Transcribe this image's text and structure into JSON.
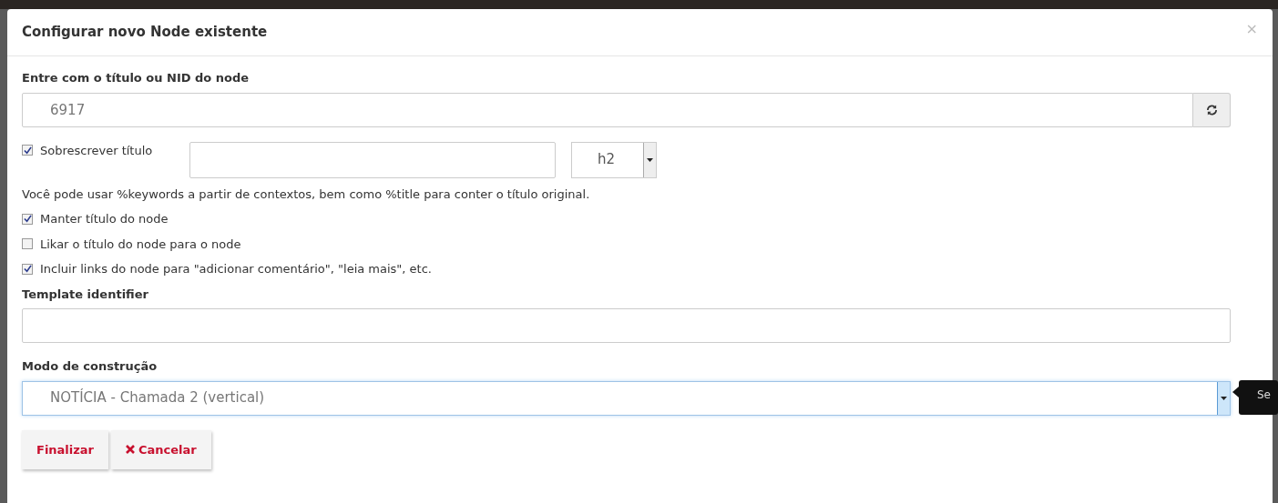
{
  "modal": {
    "title": "Configurar novo Node existente",
    "close": "×"
  },
  "node_field": {
    "label": "Entre com o título ou NID do node",
    "value": "6917"
  },
  "override": {
    "label": "Sobrescrever título",
    "checked": true,
    "heading": "h2"
  },
  "help": "Você pode usar %keywords a partir de contextos, bem como %title para conter o título original.",
  "options": [
    {
      "label": "Manter título do node",
      "checked": true
    },
    {
      "label": "Likar o título do node para o node",
      "checked": false
    },
    {
      "label": "Incluir links do node para \"adicionar comentário\", \"leia mais\", etc.",
      "checked": true
    }
  ],
  "template": {
    "label": "Template identifier"
  },
  "build_mode": {
    "label": "Modo de construção",
    "value": "NOTÍCIA - Chamada 2 (vertical)",
    "focused": true
  },
  "tooltip": "Se",
  "buttons": [
    {
      "label": "Finalizar",
      "kind": "text"
    },
    {
      "label": "Cancelar",
      "kind": "cancel"
    }
  ]
}
